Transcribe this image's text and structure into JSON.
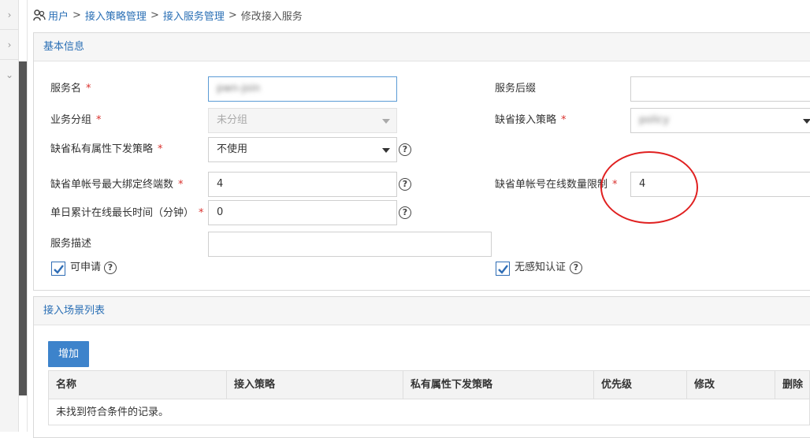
{
  "breadcrumb": {
    "items": [
      "用户",
      "接入策略管理",
      "接入服务管理"
    ],
    "separator": ">",
    "current": "修改接入服务"
  },
  "basic_panel": {
    "title": "基本信息",
    "required_mark": "*",
    "fields": {
      "service_name": {
        "label": "服务名",
        "value": "pwn-join"
      },
      "service_suffix": {
        "label": "服务后缀",
        "value": ""
      },
      "business_group": {
        "label": "业务分组",
        "value": "未分组"
      },
      "default_policy": {
        "label": "缺省接入策略",
        "value": "policy"
      },
      "private_attr_policy": {
        "label": "缺省私有属性下发策略",
        "value": "不使用"
      },
      "max_bind_terminals": {
        "label": "缺省单帐号最大绑定终端数",
        "value": "4"
      },
      "online_limit": {
        "label": "缺省单帐号在线数量限制",
        "value": "4"
      },
      "daily_online_time": {
        "label": "单日累计在线最长时间（分钟）",
        "value": "0"
      },
      "description": {
        "label": "服务描述",
        "value": ""
      }
    },
    "checkboxes": {
      "applicable": {
        "label": "可申请",
        "checked": true
      },
      "seamless_auth": {
        "label": "无感知认证",
        "checked": true
      }
    },
    "help_glyph": "?"
  },
  "scene_panel": {
    "title": "接入场景列表",
    "add_label": "增加",
    "columns": [
      "名称",
      "接入策略",
      "私有属性下发策略",
      "优先级",
      "修改",
      "删除"
    ],
    "empty_text": "未找到符合条件的记录。"
  },
  "colors": {
    "link": "#2a6fb5",
    "accent": "#3d83cb",
    "required": "#d9302c",
    "annotation": "#e02020"
  }
}
